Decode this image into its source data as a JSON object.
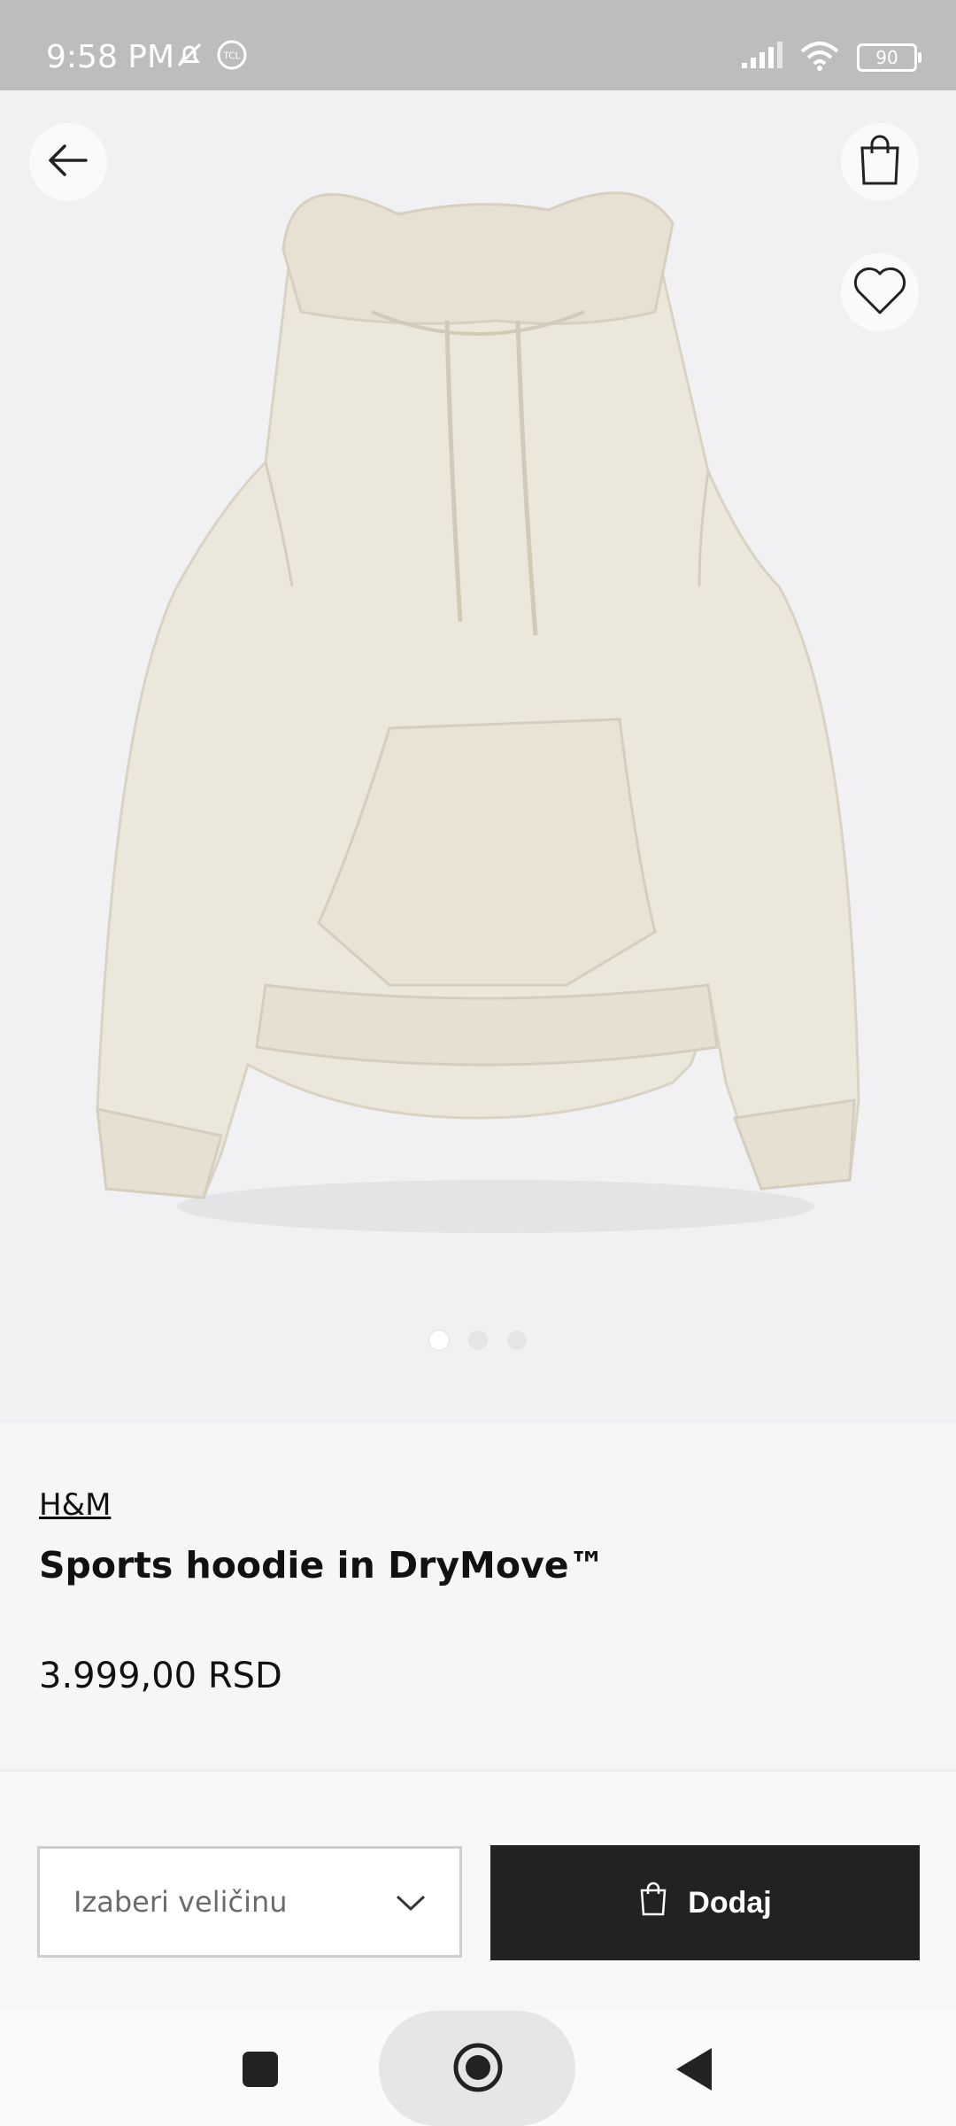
{
  "status_bar": {
    "time": "9:58 PM",
    "battery_level": "90",
    "icons": [
      "mute-icon",
      "tcl-icon",
      "signal-icon",
      "wifi-icon",
      "battery-icon"
    ]
  },
  "hero": {
    "icons": [
      "back-arrow-icon",
      "shopping-bag-icon",
      "heart-icon"
    ],
    "image_description": "beige hoodie product photo",
    "carousel": {
      "total": 3,
      "active_index": 0
    }
  },
  "product": {
    "brand": "H&M",
    "title": "Sports hoodie in DryMove™",
    "price": "3.999,00 RSD"
  },
  "actions": {
    "size_placeholder": "Izaberi veličinu",
    "add_label": "Dodaj"
  },
  "navbar": {
    "icons": [
      "recents-icon",
      "home-icon",
      "back-icon"
    ]
  },
  "colors": {
    "status_bar_bg": "#bdbdbd",
    "hero_bg": "#f1f1f3",
    "hoodie": "#ebe6d9",
    "button_dark": "#222222"
  }
}
